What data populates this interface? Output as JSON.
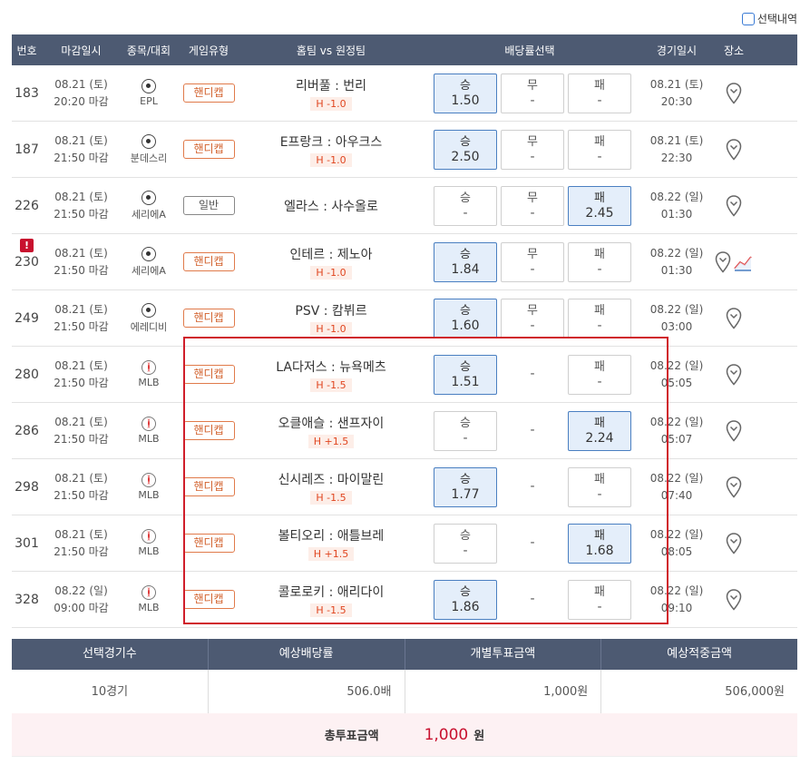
{
  "top": {
    "select_label": "선택내역"
  },
  "header": {
    "no": "번호",
    "deadline": "마감일시",
    "league": "종목/대회",
    "type": "게임유형",
    "teams": "홈팀 vs 원정팀",
    "odds": "배당률선택",
    "date": "경기일시",
    "place": "장소"
  },
  "rows": [
    {
      "no": "183",
      "dead1": "08.21 (토)",
      "dead2": "20:20 마감",
      "sport": "soccer",
      "league": "EPL",
      "type": "핸디캡",
      "match": "리버풀 : 번리",
      "hc": "H -1.0",
      "w": "1.50",
      "d": "-",
      "l": "-",
      "sel": "w",
      "date1": "08.21 (토)",
      "date2": "20:30"
    },
    {
      "no": "187",
      "dead1": "08.21 (토)",
      "dead2": "21:50 마감",
      "sport": "soccer",
      "league": "분데스리",
      "type": "핸디캡",
      "match": "E프랑크 : 아우크스",
      "hc": "H -1.0",
      "w": "2.50",
      "d": "-",
      "l": "-",
      "sel": "w",
      "date1": "08.21 (토)",
      "date2": "22:30"
    },
    {
      "no": "226",
      "dead1": "08.21 (토)",
      "dead2": "21:50 마감",
      "sport": "soccer",
      "league": "세리에A",
      "type": "일반",
      "match": "엘라스 : 사수올로",
      "hc": "",
      "w": "-",
      "d": "-",
      "l": "2.45",
      "sel": "l",
      "date1": "08.22 (일)",
      "date2": "01:30"
    },
    {
      "no": "230",
      "dead1": "08.21 (토)",
      "dead2": "21:50 마감",
      "sport": "soccer",
      "league": "세리에A",
      "type": "핸디캡",
      "match": "인테르 : 제노아",
      "hc": "H -1.0",
      "w": "1.84",
      "d": "-",
      "l": "-",
      "sel": "w",
      "date1": "08.22 (일)",
      "date2": "01:30"
    },
    {
      "no": "249",
      "dead1": "08.21 (토)",
      "dead2": "21:50 마감",
      "sport": "soccer",
      "league": "에레디비",
      "type": "핸디캡",
      "match": "PSV : 캄뷔르",
      "hc": "H -1.0",
      "w": "1.60",
      "d": "-",
      "l": "-",
      "sel": "w",
      "date1": "08.22 (일)",
      "date2": "03:00"
    },
    {
      "no": "280",
      "dead1": "08.21 (토)",
      "dead2": "21:50 마감",
      "sport": "baseball",
      "league": "MLB",
      "type": "핸디캡",
      "match": "LA다저스 : 뉴욕메츠",
      "hc": "H -1.5",
      "w": "1.51",
      "d": "-",
      "l": "-",
      "sel": "w",
      "date1": "08.22 (일)",
      "date2": "05:05"
    },
    {
      "no": "286",
      "dead1": "08.21 (토)",
      "dead2": "21:50 마감",
      "sport": "baseball",
      "league": "MLB",
      "type": "핸디캡",
      "match": "오클애슬 : 샌프자이",
      "hc": "H +1.5",
      "w": "-",
      "d": "-",
      "l": "2.24",
      "sel": "l",
      "date1": "08.22 (일)",
      "date2": "05:07"
    },
    {
      "no": "298",
      "dead1": "08.21 (토)",
      "dead2": "21:50 마감",
      "sport": "baseball",
      "league": "MLB",
      "type": "핸디캡",
      "match": "신시레즈 : 마이말린",
      "hc": "H -1.5",
      "w": "1.77",
      "d": "-",
      "l": "-",
      "sel": "w",
      "date1": "08.22 (일)",
      "date2": "07:40"
    },
    {
      "no": "301",
      "dead1": "08.21 (토)",
      "dead2": "21:50 마감",
      "sport": "baseball",
      "league": "MLB",
      "type": "핸디캡",
      "match": "볼티오리 : 애틀브레",
      "hc": "H +1.5",
      "w": "-",
      "d": "-",
      "l": "1.68",
      "sel": "l",
      "date1": "08.22 (일)",
      "date2": "08:05"
    },
    {
      "no": "328",
      "dead1": "08.22 (일)",
      "dead2": "09:00 마감",
      "sport": "baseball",
      "league": "MLB",
      "type": "핸디캡",
      "match": "콜로로키 : 애리다이",
      "hc": "H -1.5",
      "w": "1.86",
      "d": "-",
      "l": "-",
      "sel": "w",
      "date1": "08.22 (일)",
      "date2": "09:10"
    }
  ],
  "odds_labels": {
    "w": "승",
    "d": "무",
    "l": "패"
  },
  "summary": {
    "h_count": "선택경기수",
    "h_odds": "예상배당률",
    "h_bet": "개별투표금액",
    "h_win": "예상적중금액",
    "count": "10경기",
    "odds": "506.0배",
    "bet": "1,000원",
    "win": "506,000원"
  },
  "total": {
    "label": "총투표금액",
    "amount": "1,000",
    "unit": "원"
  }
}
